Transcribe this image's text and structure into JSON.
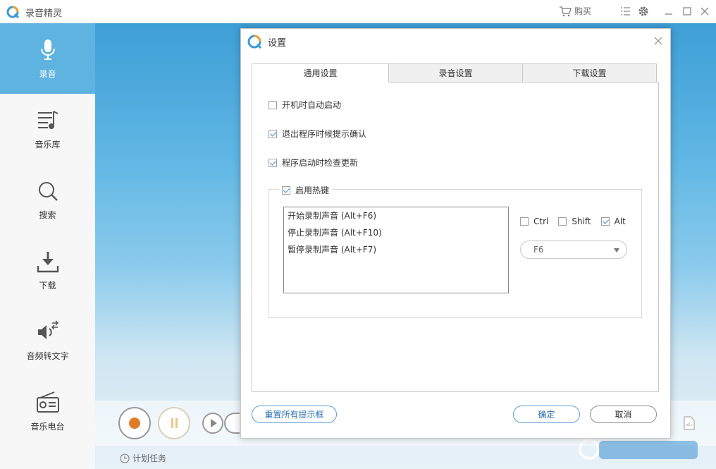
{
  "app": {
    "title": "录音精灵",
    "buy_label": "购买"
  },
  "sidebar": {
    "items": [
      {
        "label": "录音",
        "active": true
      },
      {
        "label": "音乐库"
      },
      {
        "label": "搜索"
      },
      {
        "label": "下载"
      },
      {
        "label": "音频转文字"
      },
      {
        "label": "音乐电台"
      }
    ]
  },
  "bottom": {
    "plan_task": "计划任务"
  },
  "dialog": {
    "title": "设置",
    "tabs": [
      {
        "label": "通用设置",
        "active": true
      },
      {
        "label": "录音设置"
      },
      {
        "label": "下载设置"
      }
    ],
    "general": {
      "auto_start": {
        "label": "开机时自动启动",
        "checked": false
      },
      "confirm_exit": {
        "label": "退出程序时候提示确认",
        "checked": true
      },
      "check_update": {
        "label": "程序启动时检查更新",
        "checked": true
      },
      "hotkey_group": {
        "label": "启用热键",
        "checked": true,
        "items": [
          "开始录制声音 (Alt+F6)",
          "停止录制声音 (Alt+F10)",
          "暂停录制声音 (Alt+F7)"
        ],
        "modifiers": [
          {
            "label": "Ctrl",
            "checked": false
          },
          {
            "label": "Shift",
            "checked": false
          },
          {
            "label": "Alt",
            "checked": true
          }
        ],
        "key_value": "F6"
      }
    },
    "buttons": {
      "reset": "重置所有提示框",
      "ok": "确定",
      "cancel": "取消"
    }
  },
  "colors": {
    "accent": "#5fb3e0",
    "record": "#e07b2a",
    "button_border": "#5b9fd3"
  }
}
